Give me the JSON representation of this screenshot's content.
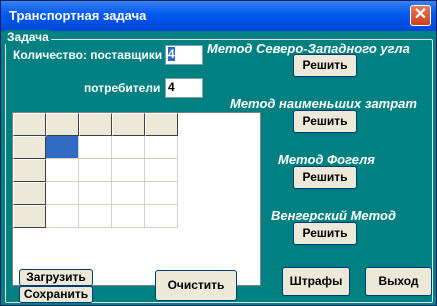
{
  "window": {
    "title": "Транспортная задача",
    "close": "✕"
  },
  "group": {
    "label": "Задача"
  },
  "inputs": {
    "suppliers_label": "Количество: поставщики",
    "suppliers_value": "4",
    "consumers_label": "потребители",
    "consumers_value": "4"
  },
  "methods": [
    {
      "title": "Метод Северо-Западного угла",
      "button": "Решить"
    },
    {
      "title": "Метод наименьших затрат",
      "button": "Решить"
    },
    {
      "title": "Метод Фогеля",
      "button": "Решить"
    },
    {
      "title": "Венгерский Метод",
      "button": "Решить"
    }
  ],
  "buttons": {
    "load": "Загрузить",
    "save": "Сохранить",
    "clear": "Очистить",
    "penalties": "Штрафы",
    "exit": "Выход"
  },
  "colors": {
    "window_bg": "#008080",
    "title_bar": "#0058EE",
    "selection": "#316AC5"
  }
}
